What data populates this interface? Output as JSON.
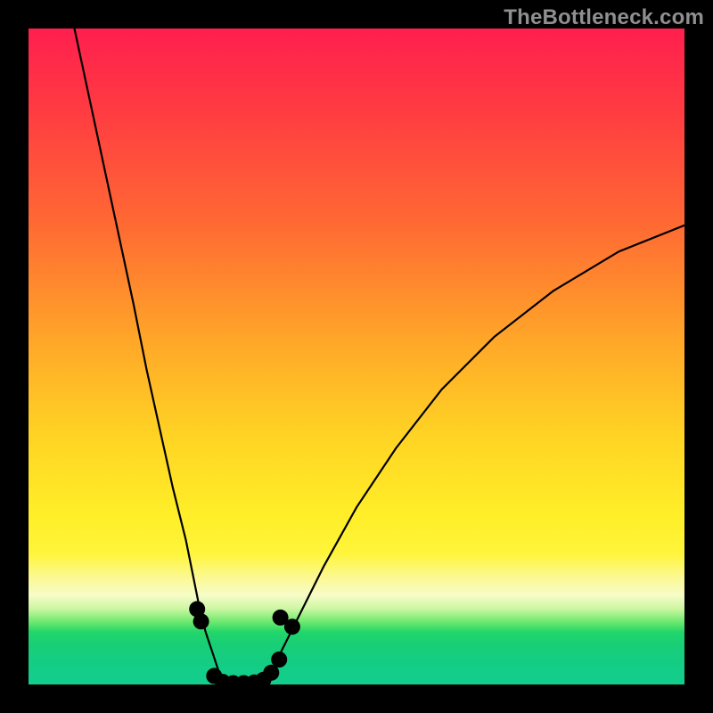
{
  "watermark": "TheBottleneck.com",
  "colors": {
    "frame": "#000000",
    "marker": "#e57373",
    "curve": "#000000",
    "gradient_top": "#ff1f4e",
    "gradient_bottom": "#12cd8d"
  },
  "chart_data": {
    "type": "line",
    "title": "",
    "xlabel": "",
    "ylabel": "",
    "xlim": [
      0,
      100
    ],
    "ylim": [
      0,
      100
    ],
    "background": "heatmap-gradient vertical red→yellow→green",
    "series": [
      {
        "name": "left-curve",
        "x": [
          7,
          10,
          13,
          16,
          18,
          20,
          22,
          24,
          25,
          26,
          27,
          28,
          29,
          30
        ],
        "y": [
          100,
          86,
          72,
          58,
          48,
          39,
          30,
          22,
          17,
          12,
          8,
          5,
          2,
          0
        ]
      },
      {
        "name": "valley-floor",
        "x": [
          30,
          33,
          36
        ],
        "y": [
          0,
          0,
          0
        ]
      },
      {
        "name": "right-curve",
        "x": [
          36,
          38,
          41,
          45,
          50,
          56,
          63,
          71,
          80,
          90,
          100
        ],
        "y": [
          0,
          4,
          10,
          18,
          27,
          36,
          45,
          53,
          60,
          66,
          70
        ]
      }
    ],
    "markers": {
      "name": "dot-cluster",
      "points": [
        {
          "x": 25.7,
          "y": 11.5
        },
        {
          "x": 26.3,
          "y": 9.6
        },
        {
          "x": 28.3,
          "y": 1.3
        },
        {
          "x": 29.6,
          "y": 0.4
        },
        {
          "x": 31.2,
          "y": 0.2
        },
        {
          "x": 32.8,
          "y": 0.2
        },
        {
          "x": 34.4,
          "y": 0.3
        },
        {
          "x": 35.8,
          "y": 0.7
        },
        {
          "x": 37.0,
          "y": 1.8
        },
        {
          "x": 38.2,
          "y": 3.8
        },
        {
          "x": 38.4,
          "y": 10.2
        },
        {
          "x": 40.2,
          "y": 8.8
        }
      ]
    }
  }
}
